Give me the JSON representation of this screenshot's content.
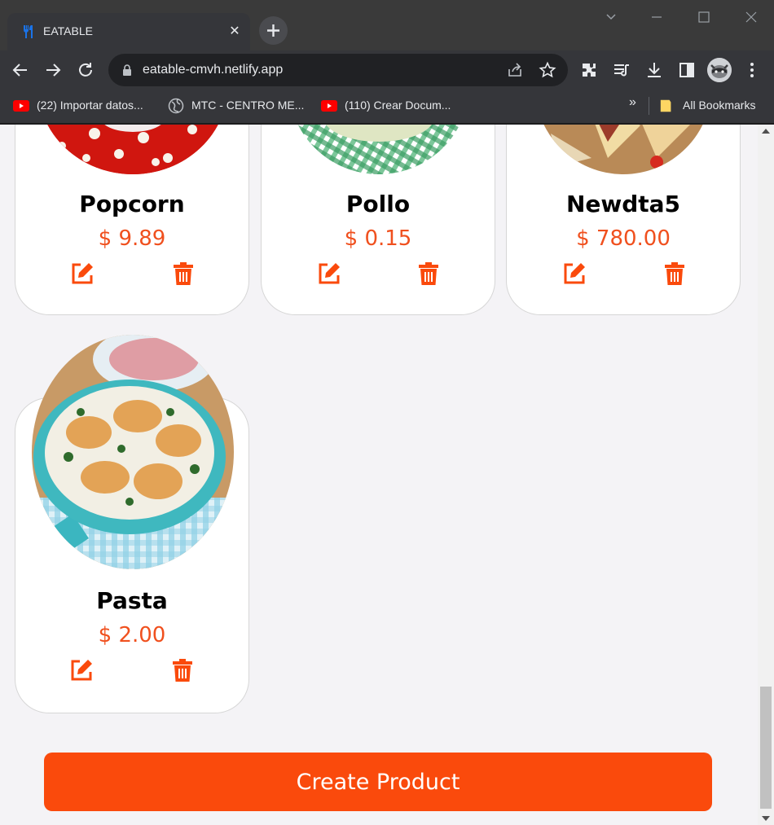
{
  "browser": {
    "tab_title": "EATABLE",
    "url": "eatable-cmvh.netlify.app",
    "bookmarks": [
      {
        "label": "(22) Importar datos...",
        "icon": "youtube-icon"
      },
      {
        "label": "MTC - CENTRO ME...",
        "icon": "globe-icon"
      },
      {
        "label": "(110) Crear Docum...",
        "icon": "youtube-icon"
      }
    ],
    "bookmarks_overflow": "»",
    "all_bookmarks": "All Bookmarks"
  },
  "products": [
    {
      "name": "Popcorn",
      "price": "$ 9.89"
    },
    {
      "name": "Pollo",
      "price": "$ 0.15"
    },
    {
      "name": "Newdta5",
      "price": "$ 780.00"
    },
    {
      "name": "Pasta",
      "price": "$ 2.00"
    }
  ],
  "create_button": "Create Product",
  "colors": {
    "accent": "#fa4a0c",
    "price": "#f0501e",
    "background": "#f4f3f6"
  }
}
